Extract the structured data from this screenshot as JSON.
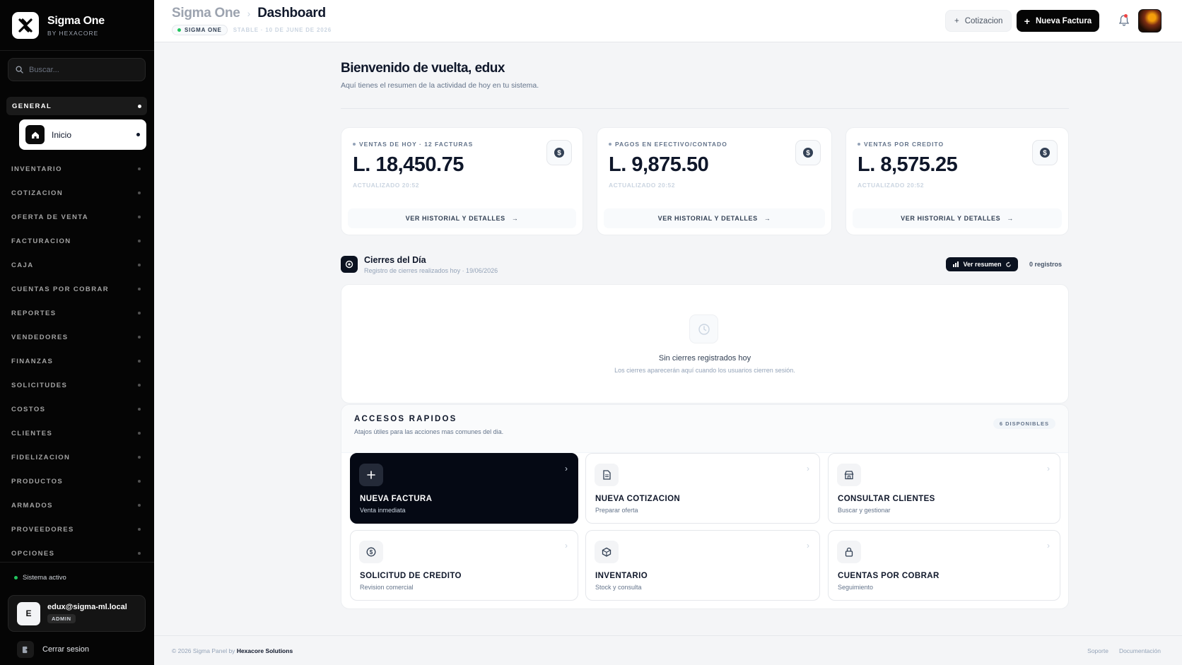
{
  "brand": {
    "title": "Sigma One",
    "subtitle": "BY HEXACORE"
  },
  "search": {
    "placeholder": "Buscar..."
  },
  "sidebar": {
    "general_label": "GENERAL",
    "active_item": "Inicio",
    "items": [
      "INVENTARIO",
      "COTIZACION",
      "OFERTA DE VENTA",
      "FACTURACION",
      "CAJA",
      "CUENTAS POR COBRAR",
      "REPORTES",
      "VENDEDORES",
      "FINANZAS",
      "SOLICITUDES",
      "COSTOS",
      "CLIENTES",
      "FIDELIZACION",
      "PRODUCTOS",
      "ARMADOS",
      "PROVEEDORES",
      "OPCIONES"
    ],
    "system_status": "Sistema activo",
    "user": {
      "initial": "E",
      "email": "edux@sigma-ml.local",
      "role": "ADMIN"
    },
    "logout_label": "Cerrar sesion"
  },
  "header": {
    "crumb_root": "Sigma One",
    "crumb_current": "Dashboard",
    "env_badge": "SIGMA ONE",
    "env_meta": "STABLE · 10 DE JUNE DE 2026",
    "btn_cotizacion": "Cotizacion",
    "btn_nueva_factura": "Nueva Factura"
  },
  "welcome": {
    "title": "Bienvenido de vuelta, edux",
    "subtitle": "Aquí tienes el resumen de la actividad de hoy en tu sistema."
  },
  "kpis": [
    {
      "label": "VENTAS DE HOY · 12 FACTURAS",
      "value": "L. 18,450.75",
      "updated": "ACTUALIZADO 20:52",
      "link": "VER HISTORIAL Y DETALLES"
    },
    {
      "label": "PAGOS EN EFECTIVO/CONTADO",
      "value": "L. 9,875.50",
      "updated": "ACTUALIZADO 20:52",
      "link": "VER HISTORIAL Y DETALLES"
    },
    {
      "label": "VENTAS POR CREDITO",
      "value": "L. 8,575.25",
      "updated": "ACTUALIZADO 20:52",
      "link": "VER HISTORIAL Y DETALLES"
    }
  ],
  "cierres": {
    "title": "Cierres del Día",
    "subtitle": "Registro de cierres realizados hoy · 19/06/2026",
    "btn_resumen": "Ver resumen",
    "registros": "0 registros",
    "empty_title": "Sin cierres registrados hoy",
    "empty_sub": "Los cierres aparecerán aquí cuando los usuarios cierren sesión."
  },
  "accesos": {
    "title": "ACCESOS RAPIDOS",
    "subtitle": "Atajos útiles para las acciones mas comunes del dia.",
    "badge": "6 DISPONIBLES",
    "tiles": [
      {
        "title": "NUEVA FACTURA",
        "sub": "Venta inmediata",
        "icon": "plus-icon"
      },
      {
        "title": "NUEVA COTIZACION",
        "sub": "Preparar oferta",
        "icon": "document-icon"
      },
      {
        "title": "CONSULTAR CLIENTES",
        "sub": "Buscar y gestionar",
        "icon": "store-icon"
      },
      {
        "title": "SOLICITUD DE CREDITO",
        "sub": "Revision comercial",
        "icon": "dollar-icon"
      },
      {
        "title": "INVENTARIO",
        "sub": "Stock y consulta",
        "icon": "box-icon"
      },
      {
        "title": "CUENTAS POR COBRAR",
        "sub": "Seguimiento",
        "icon": "lock-icon"
      }
    ]
  },
  "footer": {
    "copyright": "© 2026 Sigma Panel by",
    "company": "Hexacore Solutions",
    "links": [
      "Soporte",
      "Documentación"
    ]
  },
  "colors": {
    "sidebar_bg": "#050505",
    "primary": "#050914",
    "status_green": "#22c55e",
    "notification_red": "#ef4444"
  }
}
